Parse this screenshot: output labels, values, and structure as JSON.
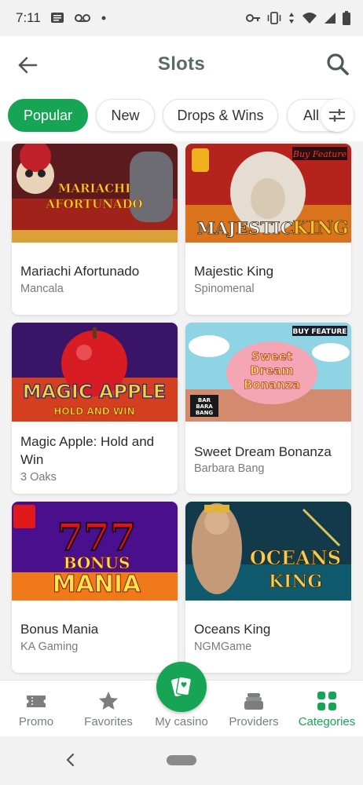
{
  "status_bar": {
    "time": "7:11",
    "icons": [
      "message-icon",
      "voicemail-icon",
      "dot-icon",
      "vpn-key-icon",
      "vibrate-icon",
      "data-arrows-icon",
      "wifi-icon",
      "signal-icon",
      "battery-icon"
    ]
  },
  "app_bar": {
    "title": "Slots"
  },
  "chips": [
    {
      "label": "Popular",
      "active": true
    },
    {
      "label": "New",
      "active": false
    },
    {
      "label": "Drops & Wins",
      "active": false
    },
    {
      "label": "All",
      "active": false
    }
  ],
  "games": [
    {
      "name": "Mariachi Afortunado",
      "provider": "Mancala",
      "badge": ""
    },
    {
      "name": "Majestic King",
      "provider": "Spinomenal",
      "badge": "Buy Feature"
    },
    {
      "name": "Magic Apple: Hold and Win",
      "provider": "3 Oaks",
      "badge": ""
    },
    {
      "name": "Sweet Dream Bonanza",
      "provider": "Barbara Bang",
      "badge": "BUY FEATURE"
    },
    {
      "name": "Bonus Mania",
      "provider": "KA Gaming",
      "badge": ""
    },
    {
      "name": "Oceans King",
      "provider": "NGMGame",
      "badge": ""
    }
  ],
  "thumb_text": {
    "mariachi": [
      "MARIACHI",
      "AFORTUNADO"
    ],
    "majestic": [
      "MAJESTIC",
      "KING"
    ],
    "magic": [
      "MAGIC APPLE",
      "HOLD AND WIN"
    ],
    "sweet": [
      "Sweet",
      "Dream",
      "Bonanza"
    ],
    "sweet_logo": [
      "BAR",
      "BARA",
      "BANG"
    ],
    "bonus": [
      "777",
      "BONUS",
      "MANIA"
    ],
    "oceans": [
      "OCEANS",
      "KING"
    ]
  },
  "bottom_nav": [
    {
      "label": "Promo",
      "icon": "ticket-icon",
      "active": false
    },
    {
      "label": "Favorites",
      "icon": "star-icon",
      "active": false
    },
    {
      "label": "My casino",
      "icon": "cards-icon",
      "active": false
    },
    {
      "label": "Providers",
      "icon": "stack-icon",
      "active": false
    },
    {
      "label": "Categories",
      "icon": "grid-icon",
      "active": true
    }
  ],
  "colors": {
    "accent": "#17a455",
    "background": "#f2f2f2",
    "title": "#5a6a66"
  }
}
